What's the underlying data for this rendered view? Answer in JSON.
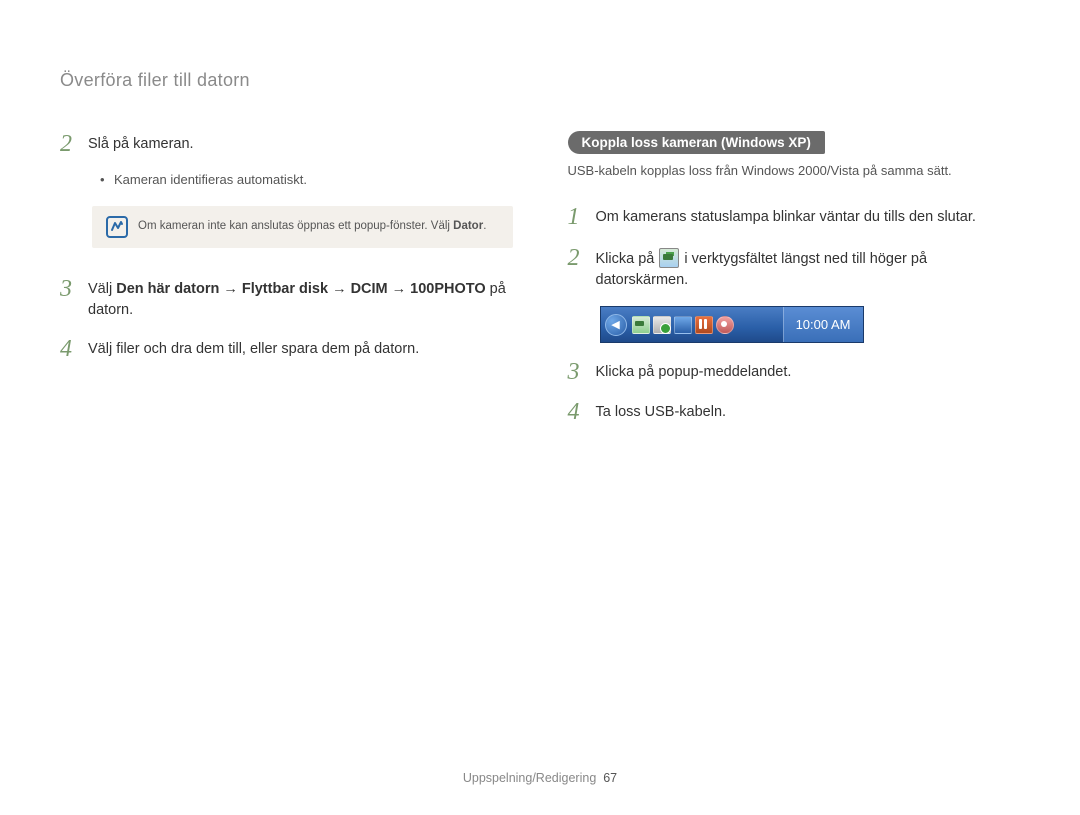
{
  "header": {
    "title": "Överföra filer till datorn"
  },
  "left": {
    "step2": {
      "num": "2",
      "text": "Slå på kameran."
    },
    "bullet2": "Kameran identifieras automatiskt.",
    "note": {
      "prefix": "Om kameran inte kan anslutas öppnas ett popup-fönster. Välj ",
      "bold": "Dator",
      "suffix": "."
    },
    "step3": {
      "num": "3",
      "prefix": "Välj ",
      "b1": "Den här datorn",
      "b2": "Flyttbar disk",
      "b3": "DCIM",
      "b4": "100PHOTO",
      "suffix": " på datorn."
    },
    "step4": {
      "num": "4",
      "text": "Välj filer och dra dem till, eller spara dem på datorn."
    }
  },
  "right": {
    "pill": "Koppla loss kameran (Windows XP)",
    "subnote": "USB-kabeln kopplas loss från Windows 2000/Vista på samma sätt.",
    "step1": {
      "num": "1",
      "text": "Om kamerans statuslampa blinkar väntar du tills den slutar."
    },
    "step2": {
      "num": "2",
      "pre": "Klicka på ",
      "post": " i verktygsfältet längst ned till höger på datorskärmen."
    },
    "taskbar": {
      "time": "10:00 AM"
    },
    "step3": {
      "num": "3",
      "text": "Klicka på popup-meddelandet."
    },
    "step4": {
      "num": "4",
      "text": "Ta loss USB-kabeln."
    }
  },
  "footer": {
    "section": "Uppspelning/Redigering",
    "page": "67"
  }
}
